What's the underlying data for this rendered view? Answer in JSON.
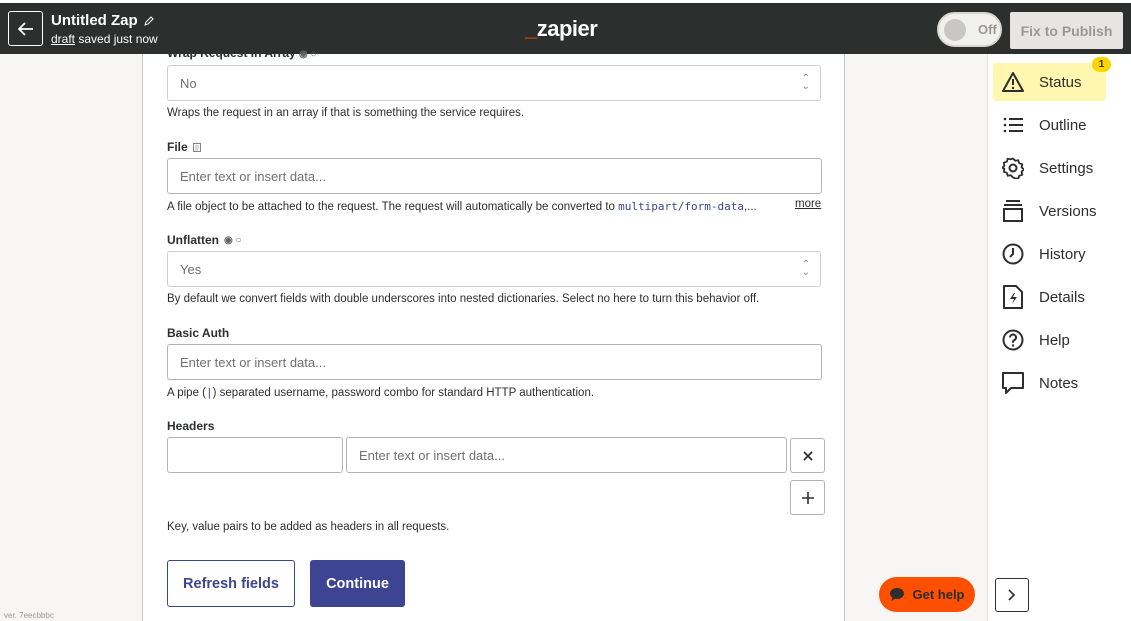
{
  "header": {
    "title": "Untitled Zap",
    "status_prefix": "draft",
    "status_suffix": " saved just now",
    "logo_text": "zapier",
    "toggle_label": "Off",
    "publish_label": "Fix to Publish",
    "accent_color": "#ff4f00"
  },
  "form": {
    "wrap_label": "Wrap Request In Array",
    "wrap_value": "No",
    "wrap_help": "Wraps the request in an array if that is something the service requires.",
    "file_label": "File",
    "file_placeholder": "Enter text or insert data...",
    "file_help_prefix": "A file object to be attached to the request. The request will automatically be converted to ",
    "file_help_code": "multipart/form-data",
    "file_help_suffix": ",...",
    "more_label": "more",
    "unflatten_label": "Unflatten",
    "unflatten_value": "Yes",
    "unflatten_help": "By default we convert fields with double underscores into nested dictionaries. Select no here to turn this behavior off.",
    "basic_auth_label": "Basic Auth",
    "basic_auth_placeholder": "Enter text or insert data...",
    "basic_auth_help_prefix": "A pipe (",
    "basic_auth_help_code": "|",
    "basic_auth_help_suffix": ") separated username, password combo for standard HTTP authentication.",
    "headers_label": "Headers",
    "headers_key_value": "",
    "headers_value_placeholder": "Enter text or insert data...",
    "headers_help": "Key, value pairs to be added as headers in all requests.",
    "refresh_label": "Refresh fields",
    "continue_label": "Continue"
  },
  "sidebar": {
    "items": [
      {
        "label": "Status",
        "icon": "warning-icon",
        "badge": "1"
      },
      {
        "label": "Outline",
        "icon": "list-icon"
      },
      {
        "label": "Settings",
        "icon": "gear-icon"
      },
      {
        "label": "Versions",
        "icon": "versions-icon"
      },
      {
        "label": "History",
        "icon": "clock-icon"
      },
      {
        "label": "Details",
        "icon": "details-icon"
      },
      {
        "label": "Help",
        "icon": "question-icon"
      },
      {
        "label": "Notes",
        "icon": "notes-icon"
      }
    ]
  },
  "get_help_label": "Get help",
  "version_text": "ver. 7eecbbbc"
}
